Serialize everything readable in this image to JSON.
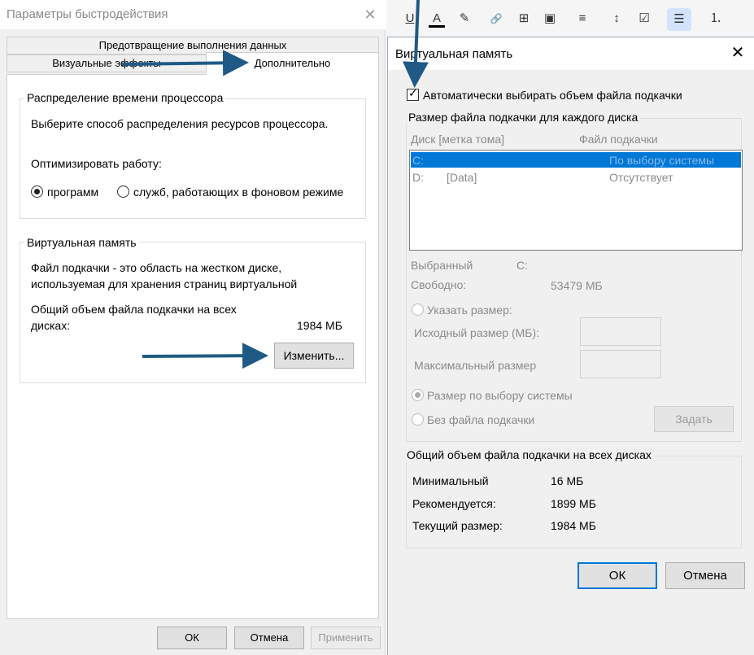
{
  "perf_dialog": {
    "title": "Параметры быстродействия",
    "close_symbol": "✕",
    "tabs": {
      "dep": "Предотвращение выполнения данных",
      "visual": "Визуальные эффекты",
      "advanced": "Дополнительно"
    },
    "cpu_group": {
      "title": "Распределение времени процессора",
      "description": "Выберите способ распределения ресурсов процессора.",
      "optimize_label": "Оптимизировать работу:",
      "option_programs": "программ",
      "option_services": "служб, работающих в фоновом режиме"
    },
    "vm_group": {
      "title": "Виртуальная память",
      "description_line1": "Файл подкачки - это область на жестком диске,",
      "description_line2": "используемая для хранения страниц виртуальной",
      "total_label_line1": "Общий объем файла подкачки на всех",
      "total_label_line2": "дисках:",
      "total_value": "1984 МБ",
      "change_button": "Изменить..."
    },
    "buttons": {
      "ok": "ОК",
      "cancel": "Отмена",
      "apply": "Применить"
    }
  },
  "toolbar": {
    "items": [
      "U",
      "A",
      "✎",
      "🔗",
      "⊞",
      "▣",
      "≡",
      "↕",
      "☑",
      "☰",
      "⒈"
    ]
  },
  "vm_dialog": {
    "title": "Виртуальная память",
    "close_symbol": "✕",
    "auto_checkbox_label": "Автоматически выбирать объем файла подкачки",
    "disk_group": {
      "title": "Размер файла подкачки для каждого диска",
      "col_disk": "Диск [метка тома]",
      "col_file": "Файл подкачки",
      "rows": [
        {
          "drive": "C:",
          "label": "",
          "file": "По выбору системы"
        },
        {
          "drive": "D:",
          "label": "[Data]",
          "file": "Отсутствует"
        }
      ],
      "selected_label": "Выбранный",
      "selected_value": "C:",
      "free_label": "Свободно:",
      "free_value": "53479 МБ",
      "custom_size_label": "Указать размер:",
      "initial_size_label": "Исходный размер (МБ):",
      "max_size_label": "Максимальный размер",
      "system_size_label": "Размер по выбору системы",
      "no_file_label": "Без файла подкачки",
      "set_button": "Задать"
    },
    "total_group": {
      "title": "Общий объем файла подкачки на всех дисках",
      "min_label": "Минимальный",
      "min_value": "16 МБ",
      "rec_label": "Рекомендуется:",
      "rec_value": "1899 МБ",
      "cur_label": "Текущий размер:",
      "cur_value": "1984 МБ"
    },
    "buttons": {
      "ok": "ОК",
      "cancel": "Отмена"
    }
  },
  "colors": {
    "selection": "#0078d7",
    "annotation_arrow": "#1f5a86"
  }
}
